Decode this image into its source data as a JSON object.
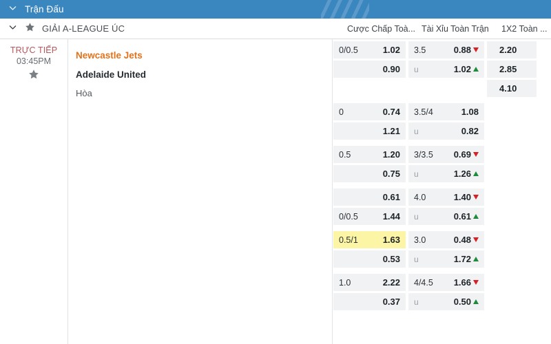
{
  "topbar": {
    "title": "Trận Đấu",
    "chevron_icon": "chevron-down-icon",
    "accent": "#3a86bf"
  },
  "league": {
    "chevron_icon": "chevron-down-icon",
    "star_icon": "star-icon",
    "name": "GIẢI A-LEAGUE ÚC"
  },
  "columns": {
    "handicap": "Cược Chấp Toà...",
    "over_under": "Tài Xỉu Toàn Trận",
    "one_x_two": "1X2 Toàn ..."
  },
  "match": {
    "status": "TRỰC TIẾP",
    "kickoff": "03:45PM",
    "star_icon": "star-icon",
    "home_team": "Newcastle Jets",
    "away_team": "Adelaide United",
    "draw_label": "Hòa",
    "home_color": "#e2721c"
  },
  "blocks": [
    {
      "handicap": {
        "top_label": "0/0.5",
        "top_value": "1.02",
        "bottom_label": "",
        "bottom_value": "0.90",
        "highlight": false
      },
      "over_under": {
        "top_label": "3.5",
        "top_value": "0.88",
        "top_trend": "down",
        "bottom_label": "u",
        "bottom_value": "1.02",
        "bottom_trend": "up"
      },
      "one_x_two": {
        "values": [
          "2.20",
          "2.85",
          "4.10"
        ]
      }
    },
    {
      "handicap": {
        "top_label": "0",
        "top_value": "0.74",
        "bottom_label": "",
        "bottom_value": "1.21",
        "highlight": false
      },
      "over_under": {
        "top_label": "3.5/4",
        "top_value": "1.08",
        "top_trend": "none",
        "bottom_label": "u",
        "bottom_value": "0.82",
        "bottom_trend": "none"
      },
      "one_x_two": {
        "values": []
      }
    },
    {
      "handicap": {
        "top_label": "0.5",
        "top_value": "1.20",
        "bottom_label": "",
        "bottom_value": "0.75",
        "highlight": false
      },
      "over_under": {
        "top_label": "3/3.5",
        "top_value": "0.69",
        "top_trend": "down",
        "bottom_label": "u",
        "bottom_value": "1.26",
        "bottom_trend": "up"
      },
      "one_x_two": {
        "values": []
      }
    },
    {
      "handicap": {
        "top_label": "",
        "top_value": "0.61",
        "bottom_label": "0/0.5",
        "bottom_value": "1.44",
        "highlight": false
      },
      "over_under": {
        "top_label": "4.0",
        "top_value": "1.40",
        "top_trend": "down",
        "bottom_label": "u",
        "bottom_value": "0.61",
        "bottom_trend": "up"
      },
      "one_x_two": {
        "values": []
      }
    },
    {
      "handicap": {
        "top_label": "0.5/1",
        "top_value": "1.63",
        "bottom_label": "",
        "bottom_value": "0.53",
        "highlight": true
      },
      "over_under": {
        "top_label": "3.0",
        "top_value": "0.48",
        "top_trend": "down",
        "bottom_label": "u",
        "bottom_value": "1.72",
        "bottom_trend": "up"
      },
      "one_x_two": {
        "values": []
      }
    },
    {
      "handicap": {
        "top_label": "1.0",
        "top_value": "2.22",
        "bottom_label": "",
        "bottom_value": "0.37",
        "highlight": false
      },
      "over_under": {
        "top_label": "4/4.5",
        "top_value": "1.66",
        "top_trend": "down",
        "bottom_label": "u",
        "bottom_value": "0.50",
        "bottom_trend": "up"
      },
      "one_x_two": {
        "values": []
      }
    }
  ],
  "trend_colors": {
    "up": "#1f8a3b",
    "down": "#d81f26"
  },
  "highlight_color": "#fbf5a5"
}
